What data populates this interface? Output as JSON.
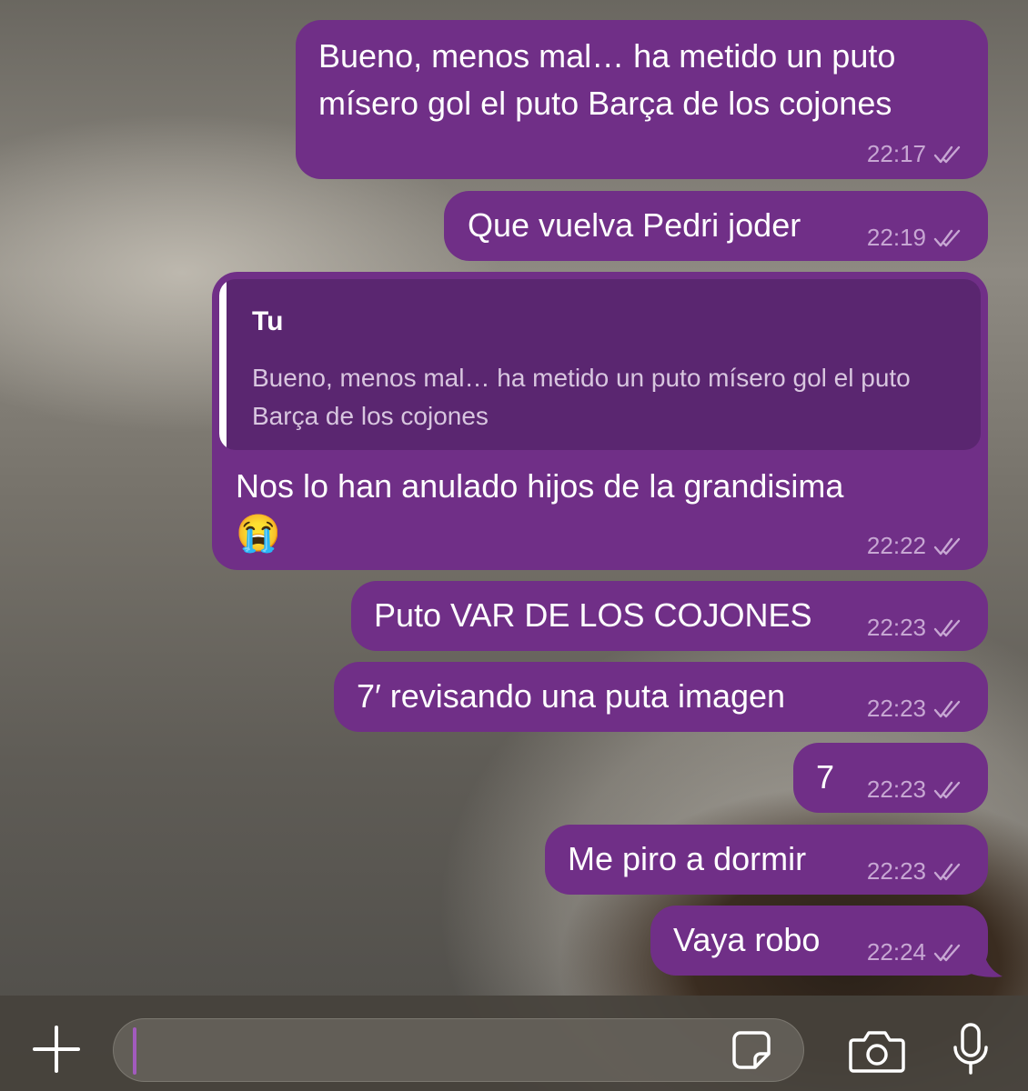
{
  "messages": [
    {
      "lines": [
        "Bueno, menos mal… ha metido un puto",
        "mísero gol el puto Barça de los cojones"
      ],
      "time": "22:17"
    },
    {
      "text": "Que vuelva Pedri joder",
      "time": "22:19"
    },
    {
      "quote": {
        "author": "Tu",
        "text": "Bueno, menos mal… ha metido un puto mísero gol el puto Barça de los cojones"
      },
      "text": "Nos lo han anulado hijos de la grandisima",
      "emoji": "😭",
      "time": "22:22"
    },
    {
      "text": "Puto VAR DE LOS COJONES",
      "time": "22:23"
    },
    {
      "text": "7′ revisando una puta imagen",
      "time": "22:23"
    },
    {
      "text": "7",
      "time": "22:23"
    },
    {
      "text": "Me piro a dormir",
      "time": "22:23"
    },
    {
      "text": "Vaya robo",
      "time": "22:24"
    }
  ],
  "composer": {
    "add_icon": "plus-icon",
    "sticker_icon": "sticker-icon",
    "camera_icon": "camera-icon",
    "mic_icon": "microphone-icon"
  },
  "colors": {
    "bubble": "#702f87",
    "quote": "#5a2670",
    "meta": "#c7a7d3"
  }
}
